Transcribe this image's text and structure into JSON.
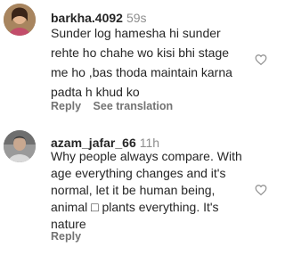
{
  "comments": [
    {
      "username": "barkha.4092",
      "time": "59s",
      "lines": [
        "Sunder log hamesha hi sunder",
        "rehte ho chahe wo kisi bhi stage",
        "me ho ,bas thoda maintain karna",
        "padta h khud ko"
      ],
      "reply_label": "Reply",
      "translation_label": "See translation",
      "avatar_icon": "user-avatar",
      "like_icon": "heart-outline-icon"
    },
    {
      "username": "azam_jafar_66",
      "time": "11h",
      "lines": [
        "Why people always compare. With",
        "age everything changes and it's",
        "normal, let it be human being,",
        "animal □ plants everything. It's",
        "nature"
      ],
      "reply_label": "Reply",
      "avatar_icon": "user-avatar",
      "like_icon": "heart-outline-icon"
    }
  ]
}
